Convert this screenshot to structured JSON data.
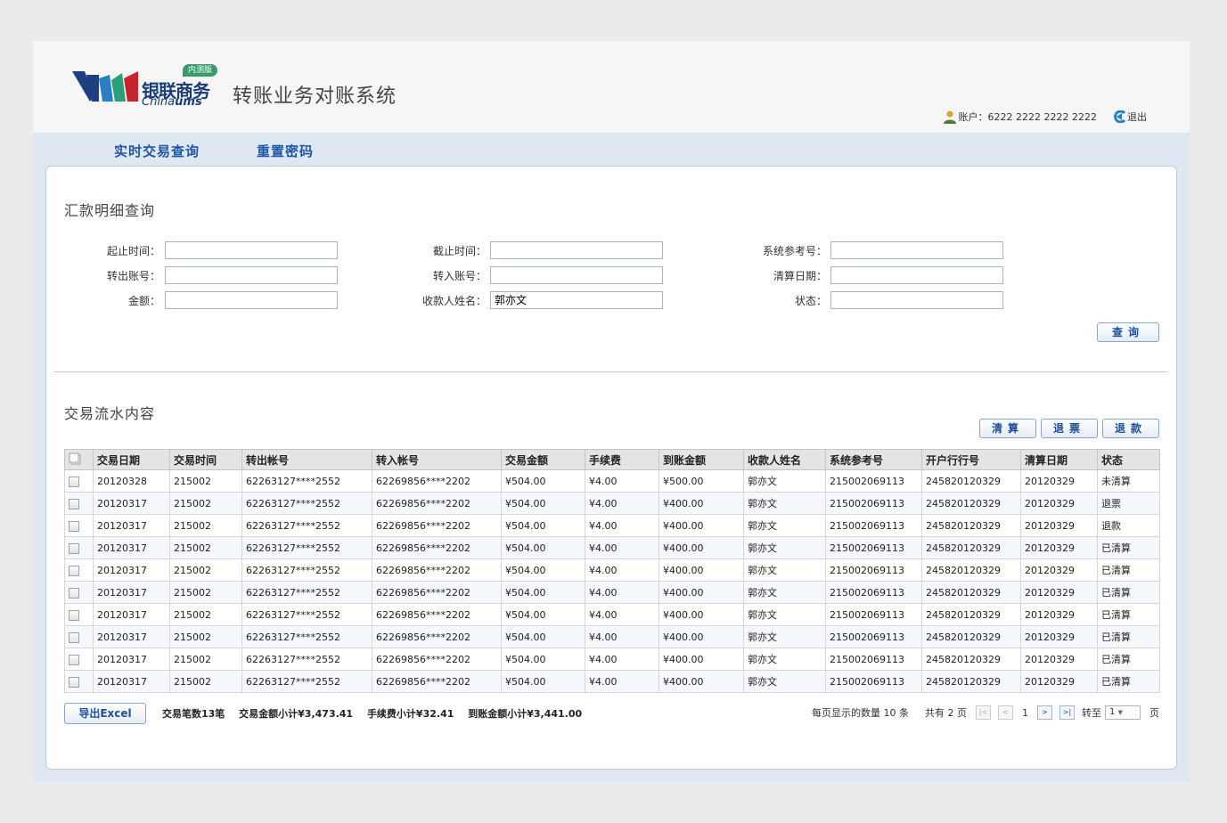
{
  "header": {
    "logo_cn": "银联商务",
    "logo_en_prefix": "China",
    "logo_en_suffix": "ums",
    "logo_badge": "内测版",
    "system_title": "转账业务对账系统",
    "account_label": "账户：6222 2222 2222 2222",
    "logout_label": "退出"
  },
  "nav": {
    "items": [
      {
        "label": "实时交易查询"
      },
      {
        "label": "重置密码"
      }
    ]
  },
  "query": {
    "section_title": "汇款明细查询",
    "fields": [
      {
        "label": "起止时间：",
        "value": ""
      },
      {
        "label": "截止时间：",
        "value": ""
      },
      {
        "label": "系统参考号：",
        "value": ""
      },
      {
        "label": "转出账号：",
        "value": ""
      },
      {
        "label": "转入账号：",
        "value": ""
      },
      {
        "label": "清算日期：",
        "value": ""
      },
      {
        "label": "金额：",
        "value": ""
      },
      {
        "label": "收款人姓名：",
        "value": "郭亦文"
      },
      {
        "label": "状态：",
        "value": ""
      }
    ],
    "search_button": "查询"
  },
  "results": {
    "section_title": "交易流水内容",
    "actions": [
      "清算",
      "退票",
      "退款"
    ],
    "columns": [
      "交易日期",
      "交易时间",
      "转出帐号",
      "转入帐号",
      "交易金额",
      "手续费",
      "到账金额",
      "收款人姓名",
      "系统参考号",
      "开户行行号",
      "清算日期",
      "状态"
    ],
    "rows": [
      [
        "20120328",
        "215002",
        "62263127****2552",
        "62269856****2202",
        "¥504.00",
        "¥4.00",
        "¥500.00",
        "郭亦文",
        "215002069113",
        "245820120329",
        "20120329",
        "未清算"
      ],
      [
        "20120317",
        "215002",
        "62263127****2552",
        "62269856****2202",
        "¥504.00",
        "¥4.00",
        "¥400.00",
        "郭亦文",
        "215002069113",
        "245820120329",
        "20120329",
        "退票"
      ],
      [
        "20120317",
        "215002",
        "62263127****2552",
        "62269856****2202",
        "¥504.00",
        "¥4.00",
        "¥400.00",
        "郭亦文",
        "215002069113",
        "245820120329",
        "20120329",
        "退款"
      ],
      [
        "20120317",
        "215002",
        "62263127****2552",
        "62269856****2202",
        "¥504.00",
        "¥4.00",
        "¥400.00",
        "郭亦文",
        "215002069113",
        "245820120329",
        "20120329",
        "已清算"
      ],
      [
        "20120317",
        "215002",
        "62263127****2552",
        "62269856****2202",
        "¥504.00",
        "¥4.00",
        "¥400.00",
        "郭亦文",
        "215002069113",
        "245820120329",
        "20120329",
        "已清算"
      ],
      [
        "20120317",
        "215002",
        "62263127****2552",
        "62269856****2202",
        "¥504.00",
        "¥4.00",
        "¥400.00",
        "郭亦文",
        "215002069113",
        "245820120329",
        "20120329",
        "已清算"
      ],
      [
        "20120317",
        "215002",
        "62263127****2552",
        "62269856****2202",
        "¥504.00",
        "¥4.00",
        "¥400.00",
        "郭亦文",
        "215002069113",
        "245820120329",
        "20120329",
        "已清算"
      ],
      [
        "20120317",
        "215002",
        "62263127****2552",
        "62269856****2202",
        "¥504.00",
        "¥4.00",
        "¥400.00",
        "郭亦文",
        "215002069113",
        "245820120329",
        "20120329",
        "已清算"
      ],
      [
        "20120317",
        "215002",
        "62263127****2552",
        "62269856****2202",
        "¥504.00",
        "¥4.00",
        "¥400.00",
        "郭亦文",
        "215002069113",
        "245820120329",
        "20120329",
        "已清算"
      ],
      [
        "20120317",
        "215002",
        "62263127****2552",
        "62269856****2202",
        "¥504.00",
        "¥4.00",
        "¥400.00",
        "郭亦文",
        "215002069113",
        "245820120329",
        "20120329",
        "已清算"
      ]
    ]
  },
  "footer": {
    "export_label": "导出Excel",
    "total_count": "交易笔数13笔",
    "total_amount": "交易金额小计¥3,473.41",
    "total_fee": "手续费小计¥32.41",
    "total_received": "到账金额小计¥3,441.00",
    "per_page_text": "每页显示的数量 10 条",
    "total_pages_text": "共有 2 页",
    "current_page": "1",
    "goto_label": "转至",
    "goto_value": "1",
    "page_unit": "页"
  },
  "colors": {
    "nav_text": "#1f57a4",
    "button_text": "#1d4f9a",
    "frame_bg": "#dfe7f3",
    "header_bg": "#f6f6f6"
  }
}
